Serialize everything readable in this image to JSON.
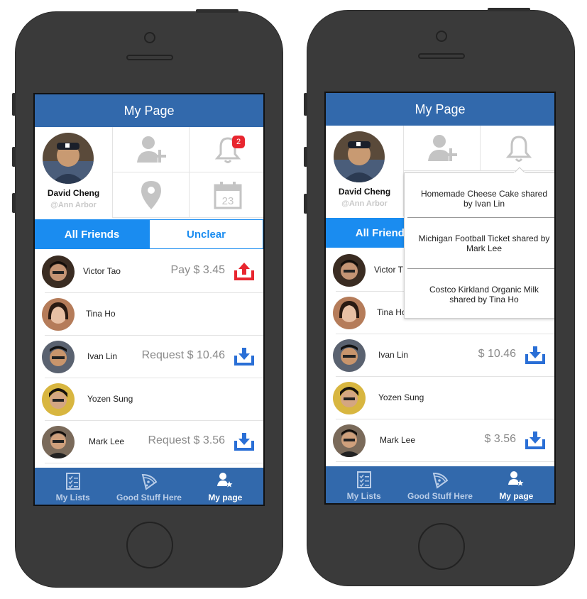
{
  "left": {
    "header_title": "My Page",
    "profile": {
      "name": "David Cheng",
      "location": "@Ann Arbor"
    },
    "notification_count": "2",
    "calendar_day": "23",
    "tabs": {
      "all_friends": "All Friends",
      "unclear": "Unclear"
    },
    "friends": [
      {
        "name": "Victor Tao",
        "amount": "Pay $ 3.45",
        "action": "pay"
      },
      {
        "name": "Tina Ho",
        "amount": "",
        "action": "none"
      },
      {
        "name": "Ivan Lin",
        "amount": "Request $ 10.46",
        "action": "request"
      },
      {
        "name": "Yozen Sung",
        "amount": "",
        "action": "none"
      },
      {
        "name": "Mark Lee",
        "amount": "Request $ 3.56",
        "action": "request"
      }
    ],
    "bottom_nav": [
      {
        "label": "My Lists",
        "icon": "checklist-icon"
      },
      {
        "label": "Good Stuff Here",
        "icon": "pizza-icon"
      },
      {
        "label": "My page",
        "icon": "user-star-icon"
      }
    ]
  },
  "right": {
    "header_title": "My Page",
    "profile": {
      "name": "David Cheng",
      "location": "@Ann Arbor"
    },
    "tabs": {
      "all_friends": "All Friends"
    },
    "notifications": [
      "Homemade Cheese Cake shared by Ivan Lin",
      "Michigan Football Ticket shared by Mark Lee",
      "Costco Kirkland Organic Milk shared by Tina Ho"
    ],
    "friends": [
      {
        "name": "Victor T",
        "amount": "",
        "action": "none"
      },
      {
        "name": "Tina Ho",
        "amount": "",
        "action": "none"
      },
      {
        "name": "Ivan Lin",
        "amount": "$ 10.46",
        "action": "request"
      },
      {
        "name": "Yozen Sung",
        "amount": "",
        "action": "none"
      },
      {
        "name": "Mark Lee",
        "amount": "$ 3.56",
        "action": "request"
      }
    ],
    "bottom_nav": [
      {
        "label": "My Lists",
        "icon": "checklist-icon"
      },
      {
        "label": "Good Stuff Here",
        "icon": "pizza-icon"
      },
      {
        "label": "My page",
        "icon": "user-star-icon"
      }
    ]
  },
  "colors": {
    "header_blue": "#3269ac",
    "tab_blue": "#1a8cf0",
    "pay_red": "#e8262f",
    "request_blue": "#2a6fd6",
    "badge_red": "#e8262f",
    "icon_gray": "#c4c4c4"
  }
}
